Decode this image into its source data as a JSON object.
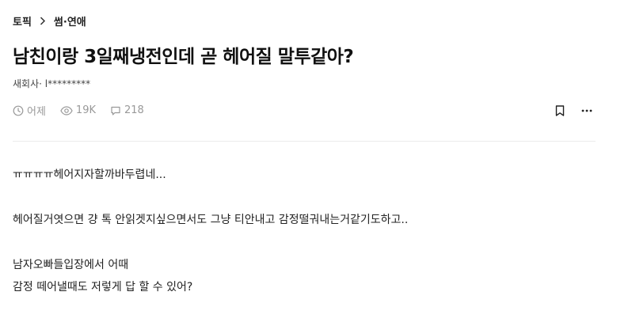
{
  "breadcrumb": {
    "root": "토픽",
    "current": "썸·연애"
  },
  "post": {
    "title": "남친이랑 3일째냉전인데 곧 헤어질 말투같아?",
    "author": "새회사· l*********",
    "date": "어제",
    "views": "19K",
    "comments": "218"
  },
  "content": {
    "line1": "ㅠㅠㅠㅠ헤어지자할까바두렵네...",
    "line2": "헤어질거엿으면 걍 톡 안읽겟지싶으면서도 그냥 티안내고 감정떨궈내는거같기도하고..",
    "line3": "남자오빠들입장에서 어때",
    "line4": "감정 떼어낼때도 저렇게 답 할 수 있어?"
  },
  "icons": {
    "breadcrumb_sep": "chevron-right-icon",
    "date": "clock-icon",
    "views": "eye-icon",
    "comments": "comment-bubble-icon",
    "bookmark": "bookmark-icon",
    "more": "more-horizontal-icon"
  },
  "colors": {
    "text": "#111111",
    "muted": "#999999",
    "divider": "#ececec"
  }
}
